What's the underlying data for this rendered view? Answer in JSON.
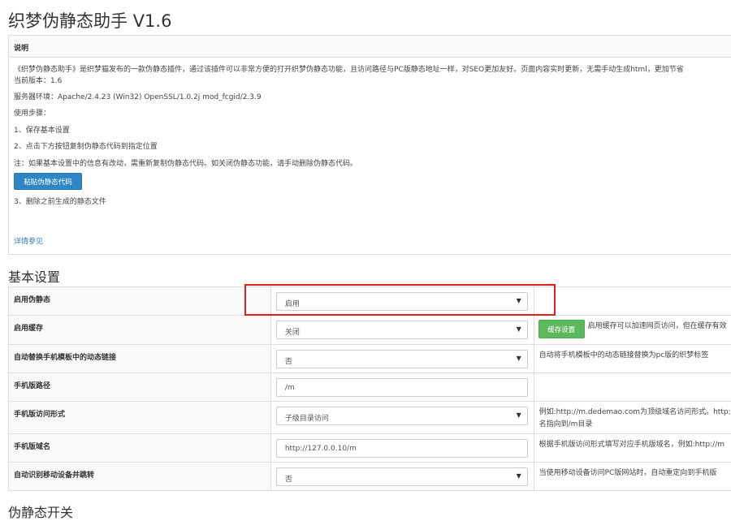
{
  "title": "织梦伪静态助手 V1.6",
  "info": {
    "header": "说明",
    "intro": "《织梦伪静态助手》是织梦猫发布的一款伪静态插件，通过该插件可以非常方便的打开织梦伪静态功能，且访问路径与PC版静态地址一样，对SEO更加友好。页面内容实时更新，无需手动生成html，更加节省",
    "version": "当前版本：1.6",
    "server_env": "服务器环境：Apache/2.4.23 (Win32) OpenSSL/1.0.2j mod_fcgid/2.3.9",
    "steps_label": "使用步骤：",
    "step1": "1、保存基本设置",
    "step2": "2、点击下方按钮复制伪静态代码到指定位置",
    "note": "注：如果基本设置中的信息有改动，需重新复制伪静态代码。如关闭伪静态功能，请手动删除伪静态代码。",
    "paste_button": "粘贴伪静态代码",
    "step3": "3、删除之前生成的静态文件",
    "more_link": "详情参见"
  },
  "basic_settings": {
    "title": "基本设置",
    "rows": [
      {
        "label": "启用伪静态",
        "type": "select",
        "value": "启用"
      },
      {
        "label": "启用缓存",
        "type": "select",
        "value": "关闭",
        "button": "缓存设置",
        "help": "启用缓存可以加速网页访问，但在缓存有效"
      },
      {
        "label": "自动替换手机模板中的动态链接",
        "type": "select",
        "value": "否",
        "help": "自动将手机模板中的动态链接替换为pc版的织梦标签"
      },
      {
        "label": "手机版路径",
        "type": "input",
        "value": "/m"
      },
      {
        "label": "手机版访问形式",
        "type": "select",
        "value": "子级目录访问",
        "help": "例如:http://m.dedemao.com为顶级域名访问形式。http://",
        "help2": "名指向到/m目录"
      },
      {
        "label": "手机版域名",
        "type": "input",
        "value": "http://127.0.0.10/m",
        "help": "根据手机版访问形式填写对应手机版域名，例如:http://m"
      },
      {
        "label": "自动识别移动设备并跳转",
        "type": "select",
        "value": "否",
        "help": "当使用移动设备访问PC版网站时，自动重定向到手机版"
      }
    ]
  },
  "rewrite_switch": {
    "title": "伪静态开关"
  },
  "icons": {
    "caret": "caret-down-icon"
  },
  "colors": {
    "primary": "#2f86c7",
    "success": "#5cb85c",
    "highlight": "#e02020",
    "link": "#337ab7"
  }
}
